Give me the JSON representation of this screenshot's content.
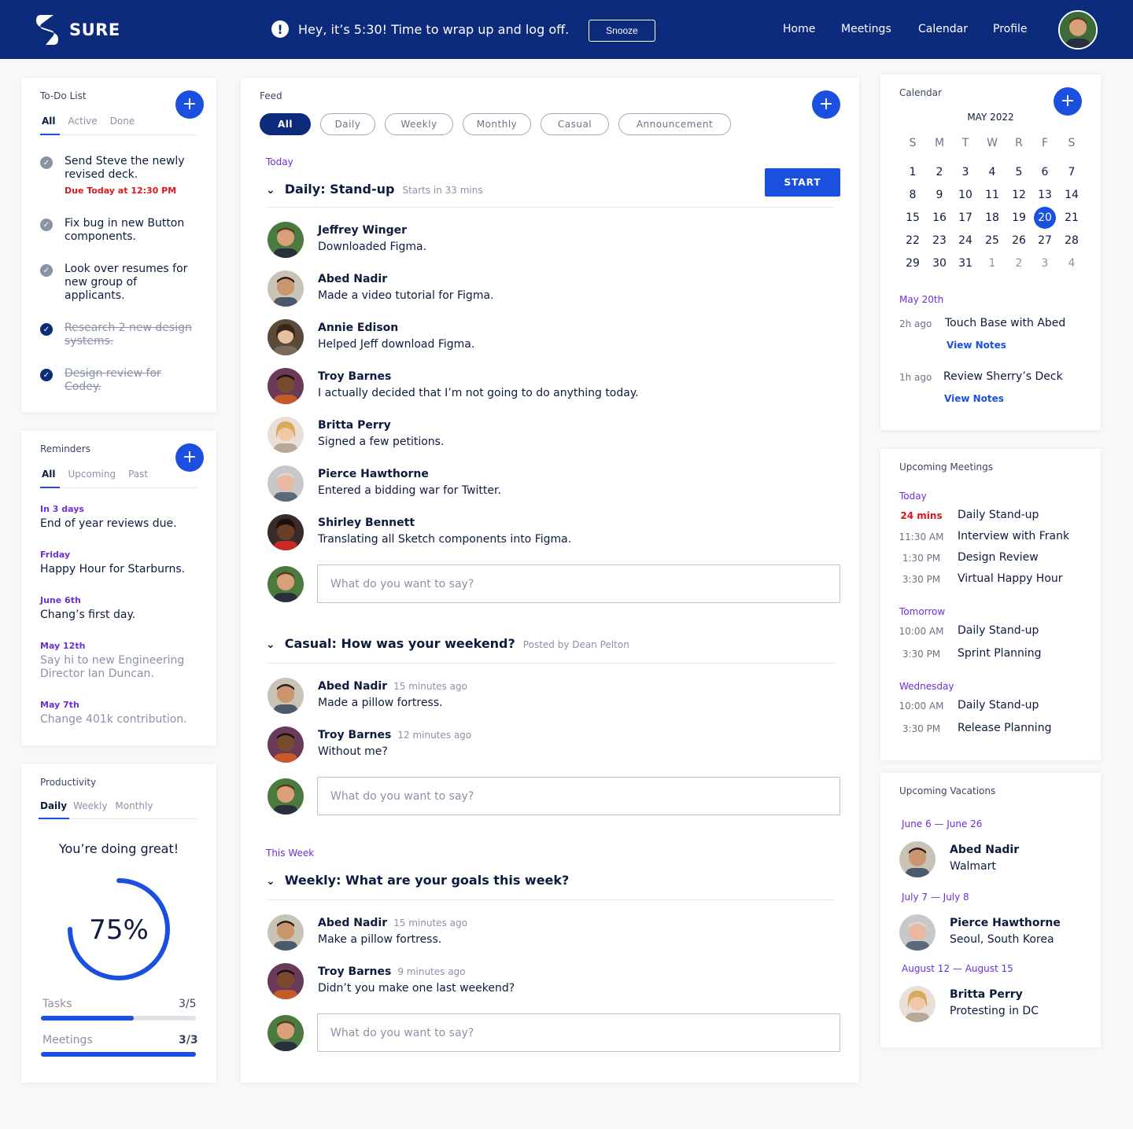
{
  "header": {
    "logo_text": "SURE",
    "alert_text": "Hey, it’s 5:30! Time to wrap up and log off.",
    "snooze_label": "Snooze",
    "nav": [
      "Home",
      "Meetings",
      "Calendar",
      "Profile"
    ]
  },
  "todo": {
    "title": "To-Do List",
    "tabs": [
      "All",
      "Active",
      "Done"
    ],
    "items": [
      {
        "text": "Send Steve the newly revised deck.",
        "due": "Due Today at 12:30 PM",
        "done": false
      },
      {
        "text": "Fix bug in new Button components.",
        "done": false
      },
      {
        "text": "Look over resumes for new group of applicants.",
        "done": false
      },
      {
        "text": "Research 2 new design systems.",
        "done": true
      },
      {
        "text": "Design review for Codey.",
        "done": true
      }
    ]
  },
  "reminders": {
    "title": "Reminders",
    "tabs": [
      "All",
      "Upcoming",
      "Past"
    ],
    "items": [
      {
        "when": "In 3 days",
        "what": "End of year reviews due."
      },
      {
        "when": "Friday",
        "what": "Happy Hour for Starburns."
      },
      {
        "when": "June 6th",
        "what": "Chang’s first day."
      },
      {
        "when": "May 12th",
        "what": "Say hi to new Engineering Director Ian Duncan."
      },
      {
        "when": "May 7th",
        "what": "Change 401k contribution."
      }
    ]
  },
  "productivity": {
    "title": "Productivity",
    "tabs": [
      "Daily",
      "Weekly",
      "Monthly"
    ],
    "message": "You’re doing great!",
    "percent_label": "75%",
    "percent": 0.75,
    "tasks_label": "Tasks",
    "tasks_value": "3/5",
    "tasks_fraction": 0.6,
    "meetings_label": "Meetings",
    "meetings_value": "3/3",
    "meetings_fraction": 1.0
  },
  "feed": {
    "title": "Feed",
    "filters": [
      "All",
      "Daily",
      "Weekly",
      "Monthly",
      "Casual",
      "Announcement"
    ],
    "today_label": "Today",
    "this_week_label": "This Week",
    "reply_placeholder": "What do you want to say?",
    "posts": [
      {
        "title": "Daily: Stand-up",
        "meta": "Starts in 33 mins",
        "action": "START",
        "entries": [
          {
            "name": "Jeffrey Winger",
            "ago": "",
            "msg": "Downloaded Figma."
          },
          {
            "name": "Abed Nadir",
            "ago": "",
            "msg": "Made a video tutorial for Figma."
          },
          {
            "name": "Annie Edison",
            "ago": "",
            "msg": "Helped Jeff download Figma."
          },
          {
            "name": "Troy Barnes",
            "ago": "",
            "msg": "I actually decided that I’m not going to do anything today."
          },
          {
            "name": "Britta Perry",
            "ago": "",
            "msg": "Signed a few petitions."
          },
          {
            "name": "Pierce Hawthorne",
            "ago": "",
            "msg": "Entered a bidding war for Twitter."
          },
          {
            "name": "Shirley Bennett",
            "ago": "",
            "msg": "Translating all Sketch components into Figma."
          }
        ]
      },
      {
        "title": "Casual: How was your weekend?",
        "meta": "Posted by Dean Pelton",
        "entries": [
          {
            "name": "Abed Nadir",
            "ago": "15 minutes ago",
            "msg": "Made a pillow fortress."
          },
          {
            "name": "Troy Barnes",
            "ago": "12 minutes ago",
            "msg": "Without me?"
          }
        ]
      },
      {
        "title": "Weekly: What are your goals this week?",
        "meta": "",
        "entries": [
          {
            "name": "Abed Nadir",
            "ago": "15 minutes ago",
            "msg": "Make a pillow fortress."
          },
          {
            "name": "Troy Barnes",
            "ago": "9 minutes ago",
            "msg": "Didn’t you make one last weekend?"
          }
        ]
      }
    ]
  },
  "calendar": {
    "title": "Calendar",
    "month": "MAY 2022",
    "dow": [
      "S",
      "M",
      "T",
      "W",
      "R",
      "F",
      "S"
    ],
    "weeks": [
      [
        "1",
        "2",
        "3",
        "4",
        "5",
        "6",
        "7"
      ],
      [
        "8",
        "9",
        "10",
        "11",
        "12",
        "13",
        "14"
      ],
      [
        "15",
        "16",
        "17",
        "18",
        "19",
        "20",
        "21"
      ],
      [
        "22",
        "23",
        "24",
        "25",
        "26",
        "27",
        "28"
      ],
      [
        "29",
        "30",
        "31",
        "1",
        "2",
        "3",
        "4"
      ]
    ],
    "selected": "20",
    "date_label": "May 20th",
    "events": [
      {
        "ago": "2h ago",
        "title": "Touch Base with Abed",
        "link": "View Notes"
      },
      {
        "ago": "1h ago",
        "title": "Review Sherry’s Deck",
        "link": "View Notes"
      }
    ]
  },
  "meetings": {
    "title": "Upcoming Meetings",
    "groups": [
      {
        "day": "Today",
        "items": [
          {
            "time": "24 mins",
            "title": "Daily Stand-up",
            "urgent": true
          },
          {
            "time": "11:30 AM",
            "title": "Interview with Frank"
          },
          {
            "time": "1:30 PM",
            "title": "Design Review"
          },
          {
            "time": "3:30 PM",
            "title": "Virtual Happy Hour"
          }
        ]
      },
      {
        "day": "Tomorrow",
        "items": [
          {
            "time": "10:00 AM",
            "title": "Daily Stand-up"
          },
          {
            "time": "3:30 PM",
            "title": "Sprint Planning"
          }
        ]
      },
      {
        "day": "Wednesday",
        "items": [
          {
            "time": "10:00 AM",
            "title": "Daily Stand-up"
          },
          {
            "time": "3:30 PM",
            "title": "Release Planning"
          }
        ]
      }
    ]
  },
  "vacations": {
    "title": "Upcoming Vacations",
    "items": [
      {
        "dates": "June 6 — June 26",
        "name": "Abed Nadir",
        "where": "Walmart"
      },
      {
        "dates": "July 7 — July 8",
        "name": "Pierce Hawthorne",
        "where": "Seoul, South Korea"
      },
      {
        "dates": "August 12 — August 15",
        "name": "Britta Perry",
        "where": "Protesting in DC"
      }
    ]
  },
  "colors": {
    "brand": "#0d2b7c",
    "accent": "#1a4fe0",
    "section": "#6c2fd6",
    "urgent": "#d7191f"
  }
}
